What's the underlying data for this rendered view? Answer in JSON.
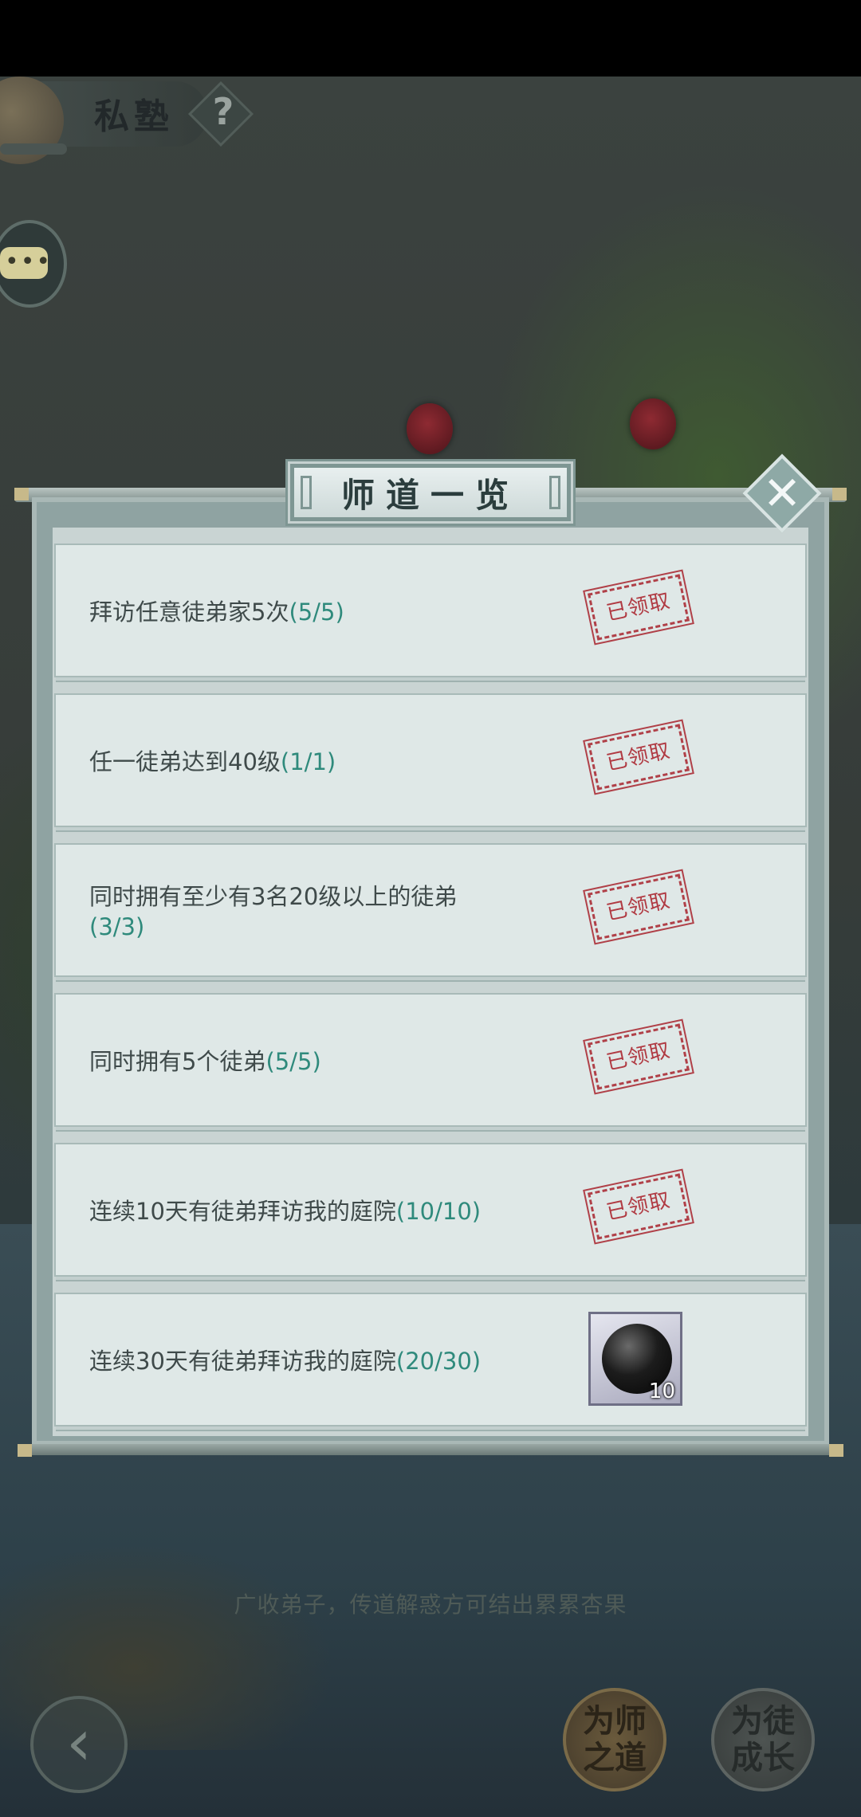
{
  "header": {
    "title": "私塾",
    "help_label": "?"
  },
  "chat": {
    "dots": "•••"
  },
  "modal": {
    "title": "师道一览",
    "close_label": "✕",
    "tasks": [
      {
        "text": "拜访任意徒弟家5次",
        "progress": "(5/5)",
        "status": "已领取"
      },
      {
        "text": "任一徒弟达到40级",
        "progress": "(1/1)",
        "status": "已领取"
      },
      {
        "text": "同时拥有至少有3名20级以上的徒弟",
        "progress": "(3/3)",
        "status": "已领取"
      },
      {
        "text": "同时拥有5个徒弟",
        "progress": "(5/5)",
        "status": "已领取"
      },
      {
        "text": "连续10天有徒弟拜访我的庭院",
        "progress": "(10/10)",
        "status": "已领取"
      },
      {
        "text": "连续30天有徒弟拜访我的庭院",
        "progress": "(20/30)",
        "reward": {
          "icon": "go-stone-icon",
          "count": "10"
        }
      }
    ]
  },
  "footer": {
    "hint": "广收弟子，传道解惑方可结出累累杏果",
    "back_label": "‹",
    "tab_master": "为师之道",
    "tab_master_line1": "为师",
    "tab_master_line2": "之道",
    "tab_student_line1": "为徒",
    "tab_student_line2": "成长"
  },
  "colors": {
    "stamp_red": "#b03a42",
    "progress_green": "#2f8a7c",
    "panel_bg": "#dfe8e7"
  }
}
